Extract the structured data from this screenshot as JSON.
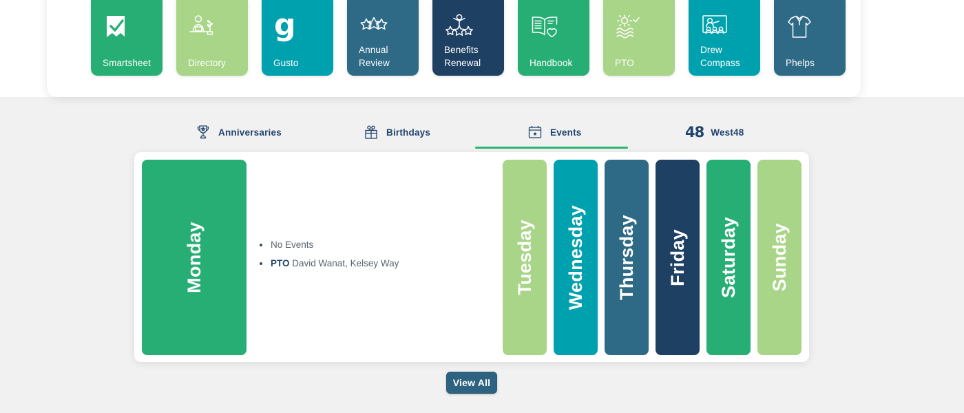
{
  "apps": {
    "tiles": [
      {
        "label": "Smartsheet",
        "icon": "checkmark-document-icon",
        "color": "#27ae74",
        "lines": 1
      },
      {
        "label": "Directory",
        "icon": "person-at-desk-icon",
        "color": "#a8d587",
        "lines": 1
      },
      {
        "label": "Gusto",
        "icon": "gusto-g-icon",
        "color": "#00a1ae",
        "lines": 1
      },
      {
        "label": "Annual Review",
        "icon": "three-stars-icon",
        "color": "#2e6a86",
        "lines": 2
      },
      {
        "label": "Benefits Renewal",
        "icon": "person-with-stars-icon",
        "color": "#1e4063",
        "lines": 2
      },
      {
        "label": "Handbook",
        "icon": "open-book-heart-icon",
        "color": "#27ae74",
        "lines": 1
      },
      {
        "label": "PTO",
        "icon": "sun-waves-icon",
        "color": "#a8d587",
        "lines": 1
      },
      {
        "label": "Drew Compass",
        "icon": "presentation-audience-icon",
        "color": "#00a1ae",
        "lines": 2
      },
      {
        "label": "Phelps",
        "icon": "polo-shirt-icon",
        "color": "#2e6a86",
        "lines": 1
      }
    ]
  },
  "tabs": {
    "items": [
      {
        "label": "Anniversaries",
        "icon": "trophy-icon",
        "active": false
      },
      {
        "label": "Birthdays",
        "icon": "gift-icon",
        "active": false
      },
      {
        "label": "Events",
        "icon": "calendar-icon",
        "active": true
      },
      {
        "label": "West48",
        "icon": "48-logo-icon",
        "active": false,
        "logo_text": "48"
      }
    ],
    "active_underline_color": "#2bb673",
    "text_color": "#20446e"
  },
  "week": {
    "days": [
      {
        "name": "Monday",
        "color": "#27ae74",
        "selected": true
      },
      {
        "name": "Tuesday",
        "color": "#a8d587",
        "selected": false
      },
      {
        "name": "Wednesday",
        "color": "#00a1ae",
        "selected": false
      },
      {
        "name": "Thursday",
        "color": "#2e6a86",
        "selected": false
      },
      {
        "name": "Friday",
        "color": "#1e4063",
        "selected": false
      },
      {
        "name": "Saturday",
        "color": "#27ae74",
        "selected": false
      },
      {
        "name": "Sunday",
        "color": "#a8d587",
        "selected": false
      }
    ],
    "events": [
      {
        "type": "",
        "text": "No Events"
      },
      {
        "type": "PTO",
        "text": "David Wanat, Kelsey Way"
      }
    ]
  },
  "footer": {
    "view_all_label": "View All"
  }
}
